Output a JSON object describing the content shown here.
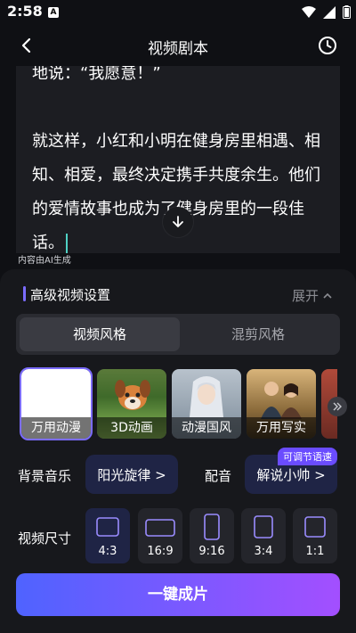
{
  "status_bar": {
    "time": "2:58",
    "notification_glyph": "A"
  },
  "header": {
    "title": "视频剧本"
  },
  "script": {
    "lines": [
      "地说：“我愿意！”",
      "",
      "就这样，小红和小明在健身房里相遇、相",
      "知、相爱，最终决定携手共度余生。他们",
      "的爱情故事也成为了健身房里的一段佳",
      "话。"
    ],
    "ai_note": "内容由AI生成"
  },
  "advanced": {
    "title": "高级视频设置",
    "expand_label": "展开"
  },
  "tabs": [
    {
      "label": "视频风格"
    },
    {
      "label": "混剪风格"
    }
  ],
  "styles": [
    {
      "label": "万用动漫"
    },
    {
      "label": "3D动画"
    },
    {
      "label": "动漫国风"
    },
    {
      "label": "万用写实"
    }
  ],
  "music": {
    "label": "背景音乐",
    "value": "阳光旋律 >"
  },
  "voice": {
    "label": "配音",
    "value": "解说小帅 >",
    "badge": "可调节语速"
  },
  "video_size": {
    "label": "视频尺寸",
    "options": [
      "4:3",
      "16:9",
      "9:16",
      "3:4",
      "1:1"
    ],
    "selected": "4:3"
  },
  "generate_label": "一键成片",
  "colors": {
    "accent": "#7b6cff",
    "pill_bg": "#1f2445",
    "gradient_start": "#4f63ff",
    "gradient_end": "#a34fff"
  }
}
